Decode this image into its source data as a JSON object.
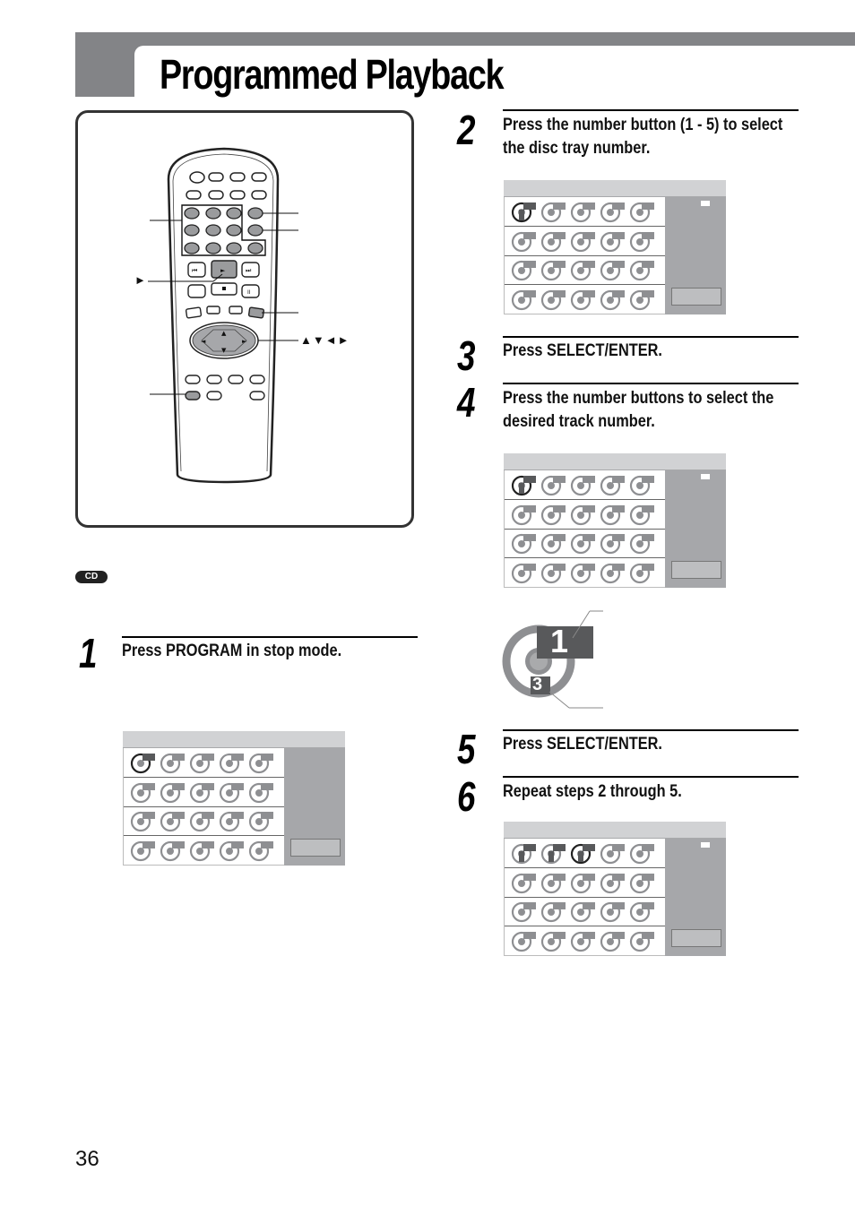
{
  "header": {
    "title": "Programmed Playback"
  },
  "remote": {
    "callout_play_symbol": "►",
    "callout_arrows": "▲▼◄►"
  },
  "media_badge": "CD",
  "steps": [
    {
      "number": "1",
      "text": "Press PROGRAM in stop mode."
    },
    {
      "number": "2",
      "text": "Press the number button (1 - 5) to select the disc tray number."
    },
    {
      "number": "3",
      "text": "Press SELECT/ENTER."
    },
    {
      "number": "4",
      "text": "Press the number buttons to select the desired track number."
    },
    {
      "number": "5",
      "text": "Press SELECT/ENTER."
    },
    {
      "number": "6",
      "text": "Repeat steps 2 through 5."
    }
  ],
  "screens": [
    {
      "id": "step1",
      "rows": 4,
      "cols": 5,
      "states": [
        "cursor"
      ],
      "flag": false
    },
    {
      "id": "step2",
      "rows": 4,
      "cols": 5,
      "states": [
        "cursor-tray"
      ],
      "flag": true
    },
    {
      "id": "step4",
      "rows": 4,
      "cols": 5,
      "states": [
        "cursor-tray"
      ],
      "flag": true
    },
    {
      "id": "step6",
      "rows": 4,
      "cols": 5,
      "states": [
        "set",
        "set",
        "cursor-tray"
      ],
      "flag": true
    }
  ],
  "disc_detail": {
    "track_number": "1",
    "tray_number": "3"
  },
  "page_number": "36",
  "colors": {
    "header_gray": "#838487",
    "panel_gray": "#a6a7aa",
    "disc_gray": "#8e8f92",
    "disc_dark": "#58595b"
  }
}
